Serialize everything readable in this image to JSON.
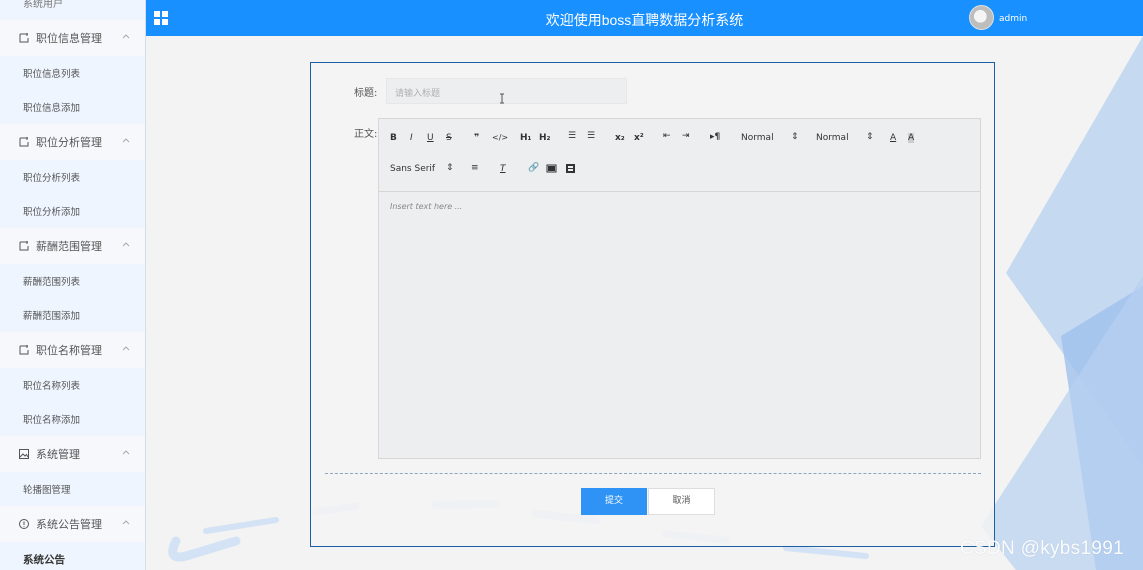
{
  "header": {
    "title": "欢迎使用boss直聘数据分析系统",
    "username": "admin"
  },
  "sidebar": {
    "top_partial": "系统用户",
    "groups": [
      {
        "label": "职位信息管理",
        "icon": "edit-icon",
        "items": [
          "职位信息列表",
          "职位信息添加"
        ]
      },
      {
        "label": "职位分析管理",
        "icon": "edit-icon",
        "items": [
          "职位分析列表",
          "职位分析添加"
        ]
      },
      {
        "label": "薪酬范围管理",
        "icon": "edit-icon",
        "items": [
          "薪酬范围列表",
          "薪酬范围添加"
        ]
      },
      {
        "label": "职位名称管理",
        "icon": "edit-icon",
        "items": [
          "职位名称列表",
          "职位名称添加"
        ]
      },
      {
        "label": "系统管理",
        "icon": "picture-icon",
        "items": [
          "轮播图管理"
        ]
      },
      {
        "label": "系统公告管理",
        "icon": "info-circle-icon",
        "items": [
          "系统公告"
        ]
      }
    ]
  },
  "form": {
    "title_label": "标题:",
    "title_placeholder": "请输入标题",
    "content_label": "正文:",
    "editor": {
      "header_select": "Normal",
      "size_select": "Normal",
      "font_select": "Sans Serif",
      "placeholder": "Insert text here ..."
    },
    "submit_label": "提交",
    "cancel_label": "取消"
  },
  "watermark": "CSDN @kybs1991",
  "colors": {
    "header": "#1890ff",
    "submit": "#2f93f5",
    "sidebar_bg": "#eef5fe",
    "card_border": "#1c5fa3"
  }
}
